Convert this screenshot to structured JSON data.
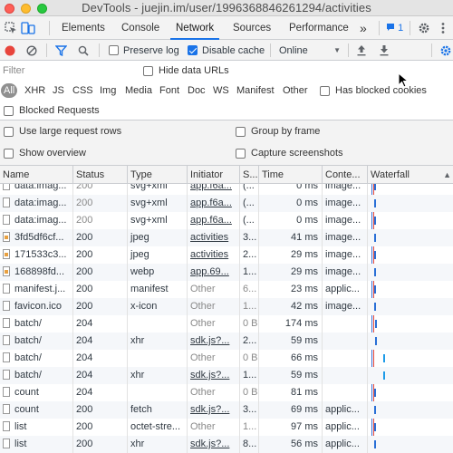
{
  "window": {
    "title": "DevTools - juejin.im/user/1996368846261294/activities"
  },
  "tabs": {
    "items": [
      "Elements",
      "Console",
      "Network",
      "Sources",
      "Performance"
    ],
    "active": "Network",
    "more": "»",
    "issues_count": "1"
  },
  "toolbar": {
    "preserve_log": "Preserve log",
    "disable_cache": "Disable cache",
    "throttling": "Online",
    "dropdown_glyph": "▼"
  },
  "filter": {
    "placeholder": "Filter",
    "hide_data_urls": "Hide data URLs"
  },
  "types": {
    "items": [
      "All",
      "XHR",
      "JS",
      "CSS",
      "Img",
      "Media",
      "Font",
      "Doc",
      "WS",
      "Manifest",
      "Other"
    ],
    "has_blocked_cookies": "Has blocked cookies",
    "blocked_requests": "Blocked Requests"
  },
  "settings": {
    "large_rows": "Use large request rows",
    "group_by_frame": "Group by frame",
    "show_overview": "Show overview",
    "capture_screenshots": "Capture screenshots"
  },
  "table": {
    "columns": [
      "Name",
      "Status",
      "Type",
      "Initiator",
      "S...",
      "Time",
      "Conte...",
      "Waterfall"
    ],
    "sort_glyph": "▲",
    "rows": [
      {
        "name": "data:imag...",
        "status": "200",
        "type": "svg+xml",
        "initiator": "app.f6a...",
        "size": "(...",
        "time": "0 ms",
        "content": "image...",
        "icon": "file",
        "dim": true,
        "link": true,
        "wf": 0
      },
      {
        "name": "data:imag...",
        "status": "200",
        "type": "svg+xml",
        "initiator": "app.f6a...",
        "size": "(...",
        "time": "0 ms",
        "content": "image...",
        "icon": "file",
        "dim": true,
        "link": true,
        "wf": 0
      },
      {
        "name": "data:imag...",
        "status": "200",
        "type": "svg+xml",
        "initiator": "app.f6a...",
        "size": "(...",
        "time": "0 ms",
        "content": "image...",
        "icon": "file",
        "dim": true,
        "link": true,
        "wf": 0
      },
      {
        "name": "3fd5df6cf...",
        "status": "200",
        "type": "jpeg",
        "initiator": "activities",
        "size": "3...",
        "time": "41 ms",
        "content": "image...",
        "icon": "img",
        "dim": false,
        "link": true,
        "wf": 0
      },
      {
        "name": "171533c3...",
        "status": "200",
        "type": "jpeg",
        "initiator": "activities",
        "size": "2...",
        "time": "29 ms",
        "content": "image...",
        "icon": "img",
        "dim": false,
        "link": true,
        "wf": 0
      },
      {
        "name": "168898fd...",
        "status": "200",
        "type": "webp",
        "initiator": "app.69...",
        "size": "1...",
        "time": "29 ms",
        "content": "image...",
        "icon": "img",
        "dim": false,
        "link": true,
        "wf": 0
      },
      {
        "name": "manifest.j...",
        "status": "200",
        "type": "manifest",
        "initiator": "Other",
        "size": "6...",
        "time": "23 ms",
        "content": "applic...",
        "icon": "file",
        "dim": false,
        "link": false,
        "wf": 0
      },
      {
        "name": "favicon.ico",
        "status": "200",
        "type": "x-icon",
        "initiator": "Other",
        "size": "1...",
        "time": "42 ms",
        "content": "image...",
        "icon": "file",
        "dim": false,
        "link": false,
        "wf": 0
      },
      {
        "name": "batch/",
        "status": "204",
        "type": "",
        "initiator": "Other",
        "size": "0 B",
        "time": "174 ms",
        "content": "",
        "icon": "file",
        "dim": false,
        "link": false,
        "wf": 1
      },
      {
        "name": "batch/",
        "status": "204",
        "type": "xhr",
        "initiator": "sdk.js?...",
        "size": "2...",
        "time": "59 ms",
        "content": "",
        "icon": "file",
        "dim": false,
        "link": true,
        "wf": 1
      },
      {
        "name": "batch/",
        "status": "204",
        "type": "",
        "initiator": "Other",
        "size": "0 B",
        "time": "66 ms",
        "content": "",
        "icon": "file",
        "dim": false,
        "link": false,
        "wf": 2
      },
      {
        "name": "batch/",
        "status": "204",
        "type": "xhr",
        "initiator": "sdk.js?...",
        "size": "1...",
        "time": "59 ms",
        "content": "",
        "icon": "file",
        "dim": false,
        "link": true,
        "wf": 2
      },
      {
        "name": "count",
        "status": "204",
        "type": "",
        "initiator": "Other",
        "size": "0 B",
        "time": "81 ms",
        "content": "",
        "icon": "file",
        "dim": false,
        "link": false,
        "wf": 0
      },
      {
        "name": "count",
        "status": "200",
        "type": "fetch",
        "initiator": "sdk.js?...",
        "size": "3...",
        "time": "69 ms",
        "content": "applic...",
        "icon": "file",
        "dim": false,
        "link": true,
        "wf": 0
      },
      {
        "name": "list",
        "status": "200",
        "type": "octet-stre...",
        "initiator": "Other",
        "size": "1...",
        "time": "97 ms",
        "content": "applic...",
        "icon": "file",
        "dim": false,
        "link": false,
        "wf": 0
      },
      {
        "name": "list",
        "status": "200",
        "type": "xhr",
        "initiator": "sdk.js?...",
        "size": "8...",
        "time": "56 ms",
        "content": "applic...",
        "icon": "file",
        "dim": false,
        "link": true,
        "wf": 0
      }
    ]
  },
  "colors": {
    "accent": "#1a73e8",
    "record": "#e8453c",
    "waterfall": "#2a6fd6"
  }
}
